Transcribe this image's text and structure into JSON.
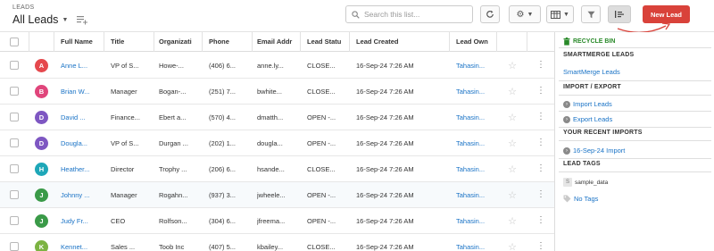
{
  "header": {
    "breadcrumb": "LEADS",
    "view_label": "All Leads",
    "search_placeholder": "Search this list...",
    "new_lead_label": "New Lead",
    "accent": "#d9423a"
  },
  "table": {
    "columns": [
      "Full Name",
      "Title",
      "Organizati",
      "Phone",
      "Email Addr",
      "Lead Statu",
      "Lead Created",
      "Lead Own"
    ],
    "rows": [
      {
        "initial": "A",
        "avatar_color": "#e5484d",
        "name": "Anne L...",
        "title": "VP of S...",
        "org": "Howe-...",
        "phone": "(406) 6...",
        "email": "anne.ly...",
        "status": "CLOSE...",
        "created": "16-Sep-24 7:26 AM",
        "owner": "Tahasin..."
      },
      {
        "initial": "B",
        "avatar_color": "#e0457b",
        "name": "Brian W...",
        "title": "Manager",
        "org": "Bogan-...",
        "phone": "(251) 7...",
        "email": "bwhite...",
        "status": "CLOSE...",
        "created": "16-Sep-24 7:26 AM",
        "owner": "Tahasin..."
      },
      {
        "initial": "D",
        "avatar_color": "#7e57c2",
        "name": "David ...",
        "title": "Finance...",
        "org": "Ebert a...",
        "phone": "(570) 4...",
        "email": "dmatth...",
        "status": "OPEN -...",
        "created": "16-Sep-24 7:26 AM",
        "owner": "Tahasin..."
      },
      {
        "initial": "D",
        "avatar_color": "#7e57c2",
        "name": "Dougla...",
        "title": "VP of S...",
        "org": "Durgan ...",
        "phone": "(202) 1...",
        "email": "dougla...",
        "status": "OPEN -...",
        "created": "16-Sep-24 7:26 AM",
        "owner": "Tahasin..."
      },
      {
        "initial": "H",
        "avatar_color": "#1ea7b8",
        "name": "Heather...",
        "title": "Director",
        "org": "Trophy ...",
        "phone": "(206) 6...",
        "email": "hsande...",
        "status": "CLOSE...",
        "created": "16-Sep-24 7:26 AM",
        "owner": "Tahasin..."
      },
      {
        "initial": "J",
        "avatar_color": "#3a9a48",
        "name": "Johnny ...",
        "title": "Manager",
        "org": "Rogahn...",
        "phone": "(937) 3...",
        "email": "jwheele...",
        "status": "OPEN -...",
        "created": "16-Sep-24 7:26 AM",
        "owner": "Tahasin..."
      },
      {
        "initial": "J",
        "avatar_color": "#3a9a48",
        "name": "Judy Fr...",
        "title": "CEO",
        "org": "Rolfson...",
        "phone": "(304) 6...",
        "email": "jfreema...",
        "status": "OPEN -...",
        "created": "16-Sep-24 7:26 AM",
        "owner": "Tahasin..."
      },
      {
        "initial": "K",
        "avatar_color": "#7cb342",
        "name": "Kennet...",
        "title": "Sales ...",
        "org": "Toob Inc",
        "phone": "(407) 5...",
        "email": "kbailey...",
        "status": "CLOSE...",
        "created": "16-Sep-24 7:26 AM",
        "owner": "Tahasin..."
      }
    ]
  },
  "sidebar": {
    "recycle_bin": "RECYCLE BIN",
    "smartmerge_heading": "SMARTMERGE LEADS",
    "smartmerge_link": "SmartMerge Leads",
    "import_export_heading": "IMPORT / EXPORT",
    "import_link": "Import Leads",
    "export_link": "Export Leads",
    "recent_imports_heading": "YOUR RECENT IMPORTS",
    "recent_import_link": "16-Sep-24 Import",
    "lead_tags_heading": "LEAD TAGS",
    "tag_letter": "S",
    "tag_name": "sample_data",
    "no_tags_link": "No Tags"
  }
}
